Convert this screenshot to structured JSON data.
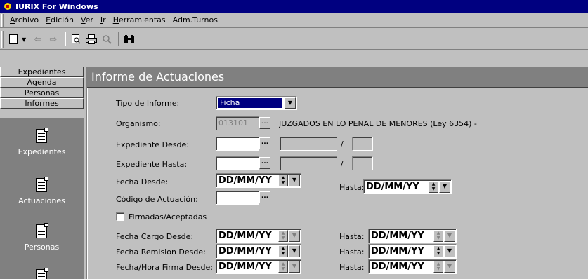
{
  "window": {
    "title": "IURIX For Windows"
  },
  "menu": [
    {
      "label": "Archivo",
      "u": "A",
      "rest": "rchivo"
    },
    {
      "label": "Edición",
      "u": "E",
      "rest": "dición"
    },
    {
      "label": "Ver",
      "u": "V",
      "rest": "er"
    },
    {
      "label": "Ir",
      "u": "I",
      "rest": "r"
    },
    {
      "label": "Herramientas",
      "u": "H",
      "rest": "erramientas"
    },
    {
      "label": "Adm.Turnos",
      "u": "",
      "rest": "Adm.Turnos"
    }
  ],
  "sidebar": {
    "tabs": [
      "Expedientes",
      "Agenda",
      "Personas",
      "Informes"
    ],
    "items": [
      "Expedientes",
      "Actuaciones",
      "Personas"
    ]
  },
  "page": {
    "title": "Informe de Actuaciones"
  },
  "form": {
    "tipo_label": "Tipo de Informe:",
    "tipo_value": "Ficha",
    "organismo_label": "Organismo:",
    "organismo_code": "013101",
    "organismo_name": "JUZGADOS EN LO PENAL DE MENORES (Ley 6354) -",
    "exp_desde_label": "Expediente Desde:",
    "exp_hasta_label": "Expediente Hasta:",
    "slash": "/",
    "fecha_desde_label": "Fecha Desde:",
    "hasta_label": "Hasta:",
    "codigo_label": "Código de Actuación:",
    "firmadas_label": "Firmadas/Aceptadas",
    "fecha_cargo_label": "Fecha Cargo Desde:",
    "fecha_remision_label": "Fecha Remision Desde:",
    "fecha_firma_label": "Fecha/Hora Firma Desde:",
    "date_placeholder": "DD/MM/YY",
    "ellipsis": "..."
  }
}
